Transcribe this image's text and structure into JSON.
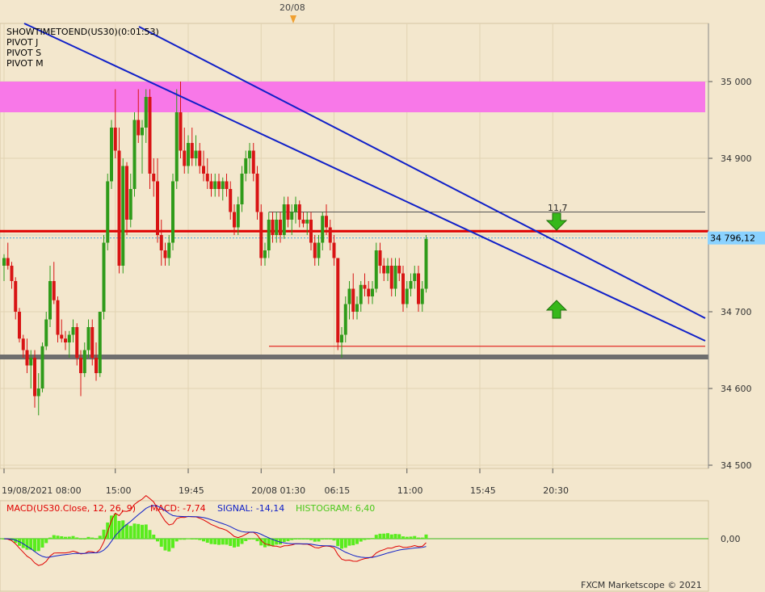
{
  "top_marker": "20/08",
  "overlay_labels": [
    "SHOWTIMETOEND(US30)(0:01:53)",
    "PIVOT J",
    "PIVOT S",
    "PIVOT M"
  ],
  "pivot_label": "11,7",
  "price_badge": "34 796,12",
  "copyright": "FXCM Marketscope © 2021",
  "colors": {
    "background": "#f3e7cd",
    "bull": "#2f9b1a",
    "bear": "#d81414",
    "trend": "#1020c8",
    "pivot_line": "#e00000",
    "support": "#6e6e6e",
    "zone": "#f878e8",
    "macd": "#e00000",
    "signal": "#1020c8",
    "histogram": "#59ec1d",
    "badge": "#8ad2ff"
  },
  "chart_data": [
    {
      "type": "candlestick",
      "instrument": "US30",
      "ylim": [
        34500,
        35050
      ],
      "y_ticks": [
        {
          "value": 35000,
          "label": "35 000"
        },
        {
          "value": 34900,
          "label": "34 900"
        },
        {
          "value": 34800,
          "label": "34 800"
        },
        {
          "value": 34700,
          "label": "34 700"
        },
        {
          "value": 34600,
          "label": "34 600"
        },
        {
          "value": 34500,
          "label": "34 500"
        }
      ],
      "x_ticks": [
        "19/08/2021 08:00",
        "15:00",
        "19:45",
        "20/08 01:30",
        "06:15",
        "11:00",
        "15:45",
        "20:30"
      ],
      "x_tick_index": [
        0,
        29,
        48,
        67,
        86,
        105,
        124,
        143
      ],
      "bar_count": 147,
      "candles": [
        [
          34760,
          34775,
          34740,
          34770
        ],
        [
          34770,
          34790,
          34755,
          34760
        ],
        [
          34760,
          34765,
          34730,
          34740
        ],
        [
          34740,
          34745,
          34690,
          34700
        ],
        [
          34700,
          34705,
          34660,
          34665
        ],
        [
          34665,
          34670,
          34640,
          34650
        ],
        [
          34650,
          34665,
          34620,
          34630
        ],
        [
          34630,
          34650,
          34600,
          34640
        ],
        [
          34640,
          34650,
          34575,
          34590
        ],
        [
          34590,
          34620,
          34565,
          34600
        ],
        [
          34600,
          34660,
          34595,
          34655
        ],
        [
          34655,
          34700,
          34650,
          34690
        ],
        [
          34690,
          34760,
          34680,
          34740
        ],
        [
          34740,
          34765,
          34710,
          34715
        ],
        [
          34715,
          34720,
          34660,
          34670
        ],
        [
          34670,
          34690,
          34660,
          34665
        ],
        [
          34665,
          34675,
          34650,
          34660
        ],
        [
          34660,
          34675,
          34640,
          34670
        ],
        [
          34670,
          34690,
          34660,
          34680
        ],
        [
          34680,
          34685,
          34630,
          34640
        ],
        [
          34640,
          34650,
          34590,
          34620
        ],
        [
          34620,
          34660,
          34615,
          34650
        ],
        [
          34650,
          34690,
          34640,
          34680
        ],
        [
          34680,
          34690,
          34630,
          34640
        ],
        [
          34640,
          34660,
          34610,
          34620
        ],
        [
          34620,
          34700,
          34615,
          34700
        ],
        [
          34700,
          34800,
          34690,
          34790
        ],
        [
          34790,
          34880,
          34780,
          34870
        ],
        [
          34870,
          34950,
          34860,
          34940
        ],
        [
          34940,
          34990,
          34900,
          34910
        ],
        [
          34910,
          34940,
          34750,
          34760
        ],
        [
          34760,
          34900,
          34750,
          34890
        ],
        [
          34890,
          34895,
          34800,
          34820
        ],
        [
          34820,
          34880,
          34810,
          34860
        ],
        [
          34860,
          34960,
          34850,
          34950
        ],
        [
          34950,
          34990,
          34920,
          34930
        ],
        [
          34930,
          34950,
          34880,
          34940
        ],
        [
          34940,
          34990,
          34920,
          34980
        ],
        [
          34980,
          34990,
          34860,
          34880
        ],
        [
          34880,
          34900,
          34850,
          34870
        ],
        [
          34870,
          34900,
          34790,
          34800
        ],
        [
          34800,
          34820,
          34760,
          34780
        ],
        [
          34780,
          34790,
          34760,
          34770
        ],
        [
          34770,
          34800,
          34760,
          34790
        ],
        [
          34790,
          34880,
          34780,
          34870
        ],
        [
          34870,
          34990,
          34860,
          34960
        ],
        [
          34960,
          35000,
          34900,
          34910
        ],
        [
          34910,
          34940,
          34880,
          34890
        ],
        [
          34890,
          34930,
          34880,
          34920
        ],
        [
          34920,
          34940,
          34890,
          34900
        ],
        [
          34900,
          34930,
          34890,
          34910
        ],
        [
          34910,
          34920,
          34880,
          34890
        ],
        [
          34890,
          34910,
          34870,
          34880
        ],
        [
          34880,
          34900,
          34860,
          34870
        ],
        [
          34870,
          34880,
          34850,
          34860
        ],
        [
          34860,
          34880,
          34850,
          34870
        ],
        [
          34870,
          34880,
          34850,
          34860
        ],
        [
          34860,
          34875,
          34845,
          34870
        ],
        [
          34870,
          34880,
          34850,
          34860
        ],
        [
          34860,
          34870,
          34820,
          34830
        ],
        [
          34830,
          34840,
          34800,
          34810
        ],
        [
          34810,
          34850,
          34800,
          34840
        ],
        [
          34840,
          34890,
          34830,
          34880
        ],
        [
          34880,
          34910,
          34870,
          34900
        ],
        [
          34900,
          34920,
          34880,
          34910
        ],
        [
          34910,
          34920,
          34870,
          34880
        ],
        [
          34880,
          34890,
          34820,
          34830
        ],
        [
          34830,
          34840,
          34760,
          34770
        ],
        [
          34770,
          34790,
          34760,
          34780
        ],
        [
          34780,
          34830,
          34770,
          34820
        ],
        [
          34820,
          34830,
          34790,
          34800
        ],
        [
          34800,
          34830,
          34790,
          34820
        ],
        [
          34820,
          34830,
          34790,
          34800
        ],
        [
          34800,
          34850,
          34795,
          34840
        ],
        [
          34840,
          34850,
          34810,
          34820
        ],
        [
          34820,
          34840,
          34800,
          34830
        ],
        [
          34830,
          34850,
          34815,
          34840
        ],
        [
          34840,
          34845,
          34810,
          34820
        ],
        [
          34820,
          34830,
          34810,
          34815
        ],
        [
          34815,
          34830,
          34800,
          34820
        ],
        [
          34820,
          34830,
          34780,
          34790
        ],
        [
          34790,
          34800,
          34760,
          34770
        ],
        [
          34770,
          34800,
          34760,
          34790
        ],
        [
          34790,
          34830,
          34780,
          34825
        ],
        [
          34825,
          34840,
          34800,
          34810
        ],
        [
          34810,
          34820,
          34780,
          34790
        ],
        [
          34790,
          34800,
          34760,
          34770
        ],
        [
          34770,
          34760,
          34650,
          34660
        ],
        [
          34660,
          34680,
          34640,
          34670
        ],
        [
          34670,
          34720,
          34660,
          34710
        ],
        [
          34710,
          34740,
          34690,
          34730
        ],
        [
          34730,
          34750,
          34690,
          34700
        ],
        [
          34700,
          34720,
          34690,
          34710
        ],
        [
          34710,
          34740,
          34700,
          34735
        ],
        [
          34735,
          34750,
          34720,
          34730
        ],
        [
          34730,
          34740,
          34710,
          34720
        ],
        [
          34720,
          34740,
          34710,
          34730
        ],
        [
          34730,
          34790,
          34725,
          34780
        ],
        [
          34780,
          34790,
          34750,
          34760
        ],
        [
          34760,
          34770,
          34740,
          34750
        ],
        [
          34750,
          34770,
          34740,
          34760
        ],
        [
          34760,
          34770,
          34720,
          34730
        ],
        [
          34730,
          34770,
          34720,
          34760
        ],
        [
          34760,
          34770,
          34740,
          34750
        ],
        [
          34750,
          34760,
          34700,
          34710
        ],
        [
          34710,
          34740,
          34705,
          34730
        ],
        [
          34730,
          34750,
          34720,
          34740
        ],
        [
          34740,
          34760,
          34730,
          34750
        ],
        [
          34750,
          34760,
          34700,
          34710
        ],
        [
          34710,
          34740,
          34700,
          34730
        ],
        [
          34730,
          34800,
          34725,
          34795
        ]
      ],
      "pivot_levels": [
        {
          "name": "PIVOT J",
          "value": 34805
        },
        {
          "name": "PIVOT S",
          "value": 34641
        },
        {
          "name": "PIVOT M",
          "value": 34655
        }
      ],
      "resistance_zone": [
        34960,
        35000
      ],
      "current_price": 34796.12
    },
    {
      "type": "macd",
      "title": "MACD(US30.Close, 12, 26, 9)",
      "macd_label": "MACD: -7,74",
      "signal_label": "SIGNAL: -14,14",
      "histogram_label": "HISTOGRAM: 6,40",
      "zero_label": "0,00",
      "macd": -7.74,
      "signal": -14.14,
      "histogram": 6.4
    }
  ]
}
